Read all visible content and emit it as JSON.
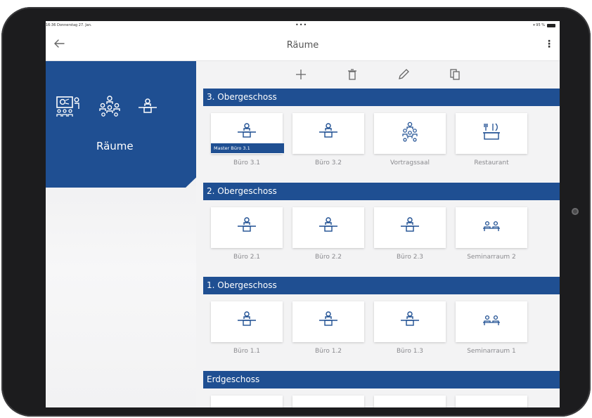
{
  "status_bar": {
    "time_date": "16:36  Donnerstag 27. Jan.",
    "center_dots": "•••",
    "battery_text": "▾ 95 %"
  },
  "nav": {
    "back_icon": "arrow-left-icon",
    "title": "Räume",
    "more_icon": "⋮"
  },
  "left_panel": {
    "label": "Räume",
    "icons": [
      "presentation-icon",
      "group-icon",
      "desk-person-icon"
    ]
  },
  "toolbar": {
    "items": [
      {
        "name": "add-icon"
      },
      {
        "name": "delete-icon"
      },
      {
        "name": "edit-icon"
      },
      {
        "name": "copy-icon"
      }
    ]
  },
  "colors": {
    "brand_blue": "#1f4f92",
    "tile_label": "#8a8a8e",
    "background": "#f3f3f4"
  },
  "sections": [
    {
      "title": "3. Obergeschoss",
      "rooms": [
        {
          "label": "Büro 3.1",
          "icon": "desk-person",
          "badge": "Master Büro 3.1"
        },
        {
          "label": "Büro 3.2",
          "icon": "desk-person"
        },
        {
          "label": "Vortragssaal",
          "icon": "audience"
        },
        {
          "label": "Restaurant",
          "icon": "restaurant"
        }
      ]
    },
    {
      "title": "2. Obergeschoss",
      "rooms": [
        {
          "label": "Büro 2.1",
          "icon": "desk-person"
        },
        {
          "label": "Büro 2.2",
          "icon": "desk-person"
        },
        {
          "label": "Büro 2.3",
          "icon": "desk-person"
        },
        {
          "label": "Seminarraum 2",
          "icon": "seminar"
        }
      ]
    },
    {
      "title": "1. Obergeschoss",
      "rooms": [
        {
          "label": "Büro 1.1",
          "icon": "desk-person"
        },
        {
          "label": "Büro 1.2",
          "icon": "desk-person"
        },
        {
          "label": "Büro 1.3",
          "icon": "desk-person"
        },
        {
          "label": "Seminarraum 1",
          "icon": "seminar"
        }
      ]
    },
    {
      "title": "Erdgeschoss",
      "rooms": [
        {
          "label": "",
          "icon": ""
        },
        {
          "label": "",
          "icon": ""
        },
        {
          "label": "",
          "icon": ""
        },
        {
          "label": "",
          "icon": ""
        }
      ]
    }
  ]
}
